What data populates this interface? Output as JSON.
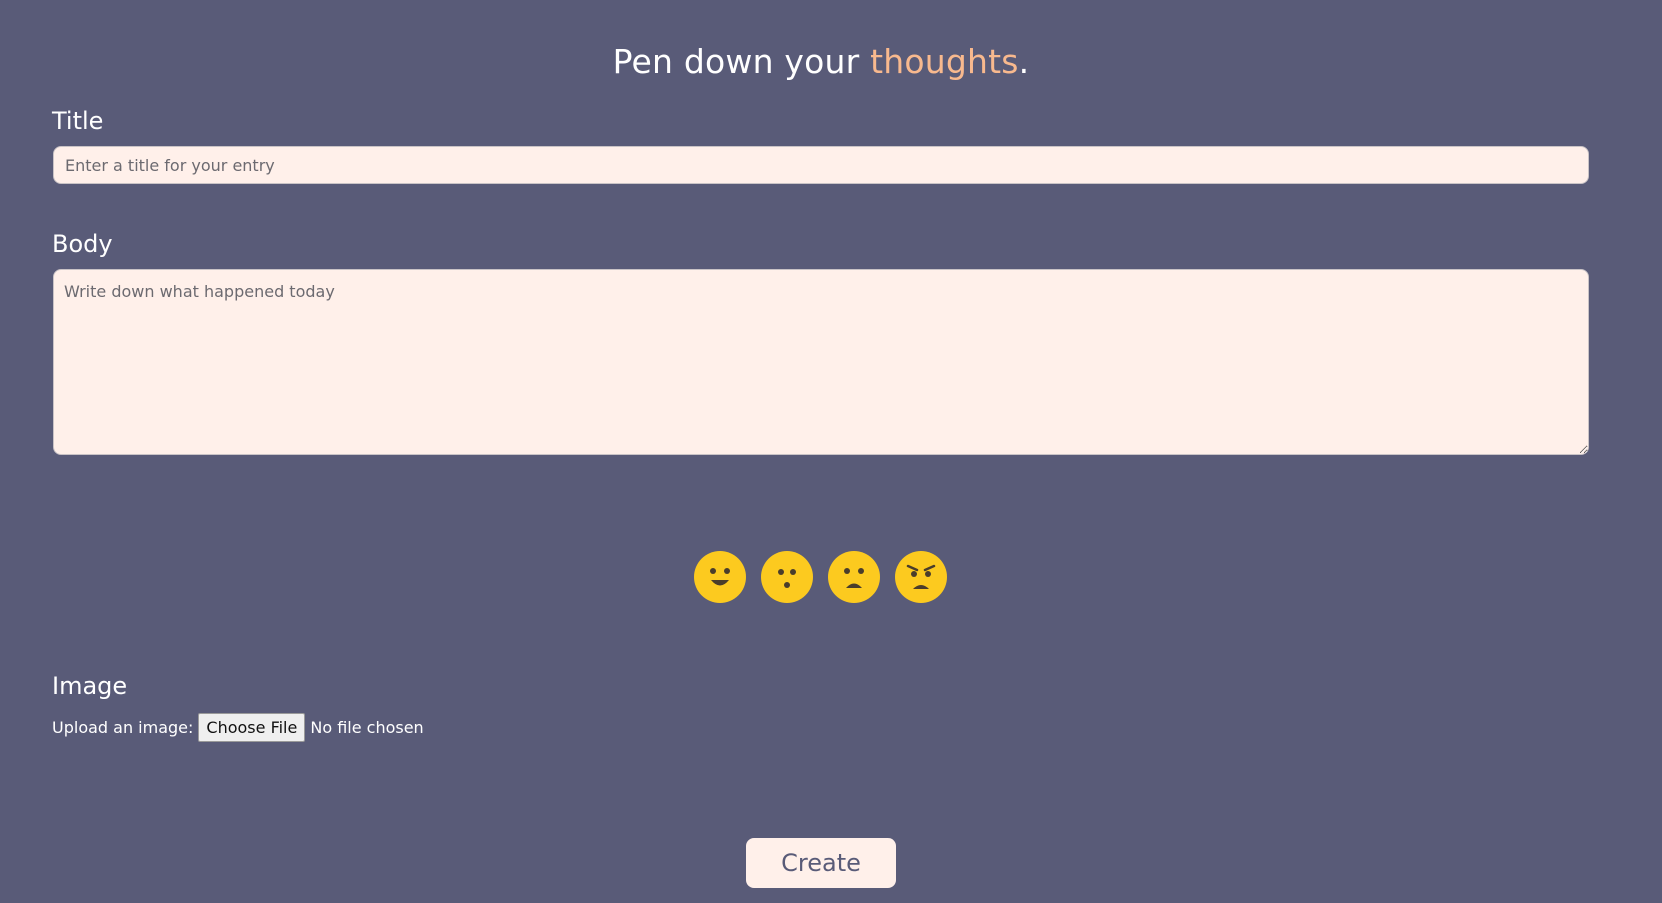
{
  "header": {
    "title_prefix": "Pen down your ",
    "title_accent": "thoughts",
    "title_suffix": ".",
    "accent_color": "#f8b98e"
  },
  "colors": {
    "background": "#595b78",
    "input_background": "#fff0ea",
    "emoji_yellow": "#fcca1f",
    "text": "#ffffff"
  },
  "form": {
    "title_label": "Title",
    "title_placeholder": "Enter a title for your entry",
    "title_value": "",
    "body_label": "Body",
    "body_placeholder": "Write down what happened today",
    "body_value": "",
    "moods": [
      {
        "name": "happy",
        "icon": "happy-face-icon"
      },
      {
        "name": "surprised",
        "icon": "surprised-face-icon"
      },
      {
        "name": "sad",
        "icon": "sad-face-icon"
      },
      {
        "name": "angry",
        "icon": "angry-face-icon"
      }
    ],
    "image_label": "Image",
    "upload_label": "Upload an image:",
    "file_button_label": "Choose File",
    "file_status": "No file chosen",
    "create_button_label": "Create"
  }
}
